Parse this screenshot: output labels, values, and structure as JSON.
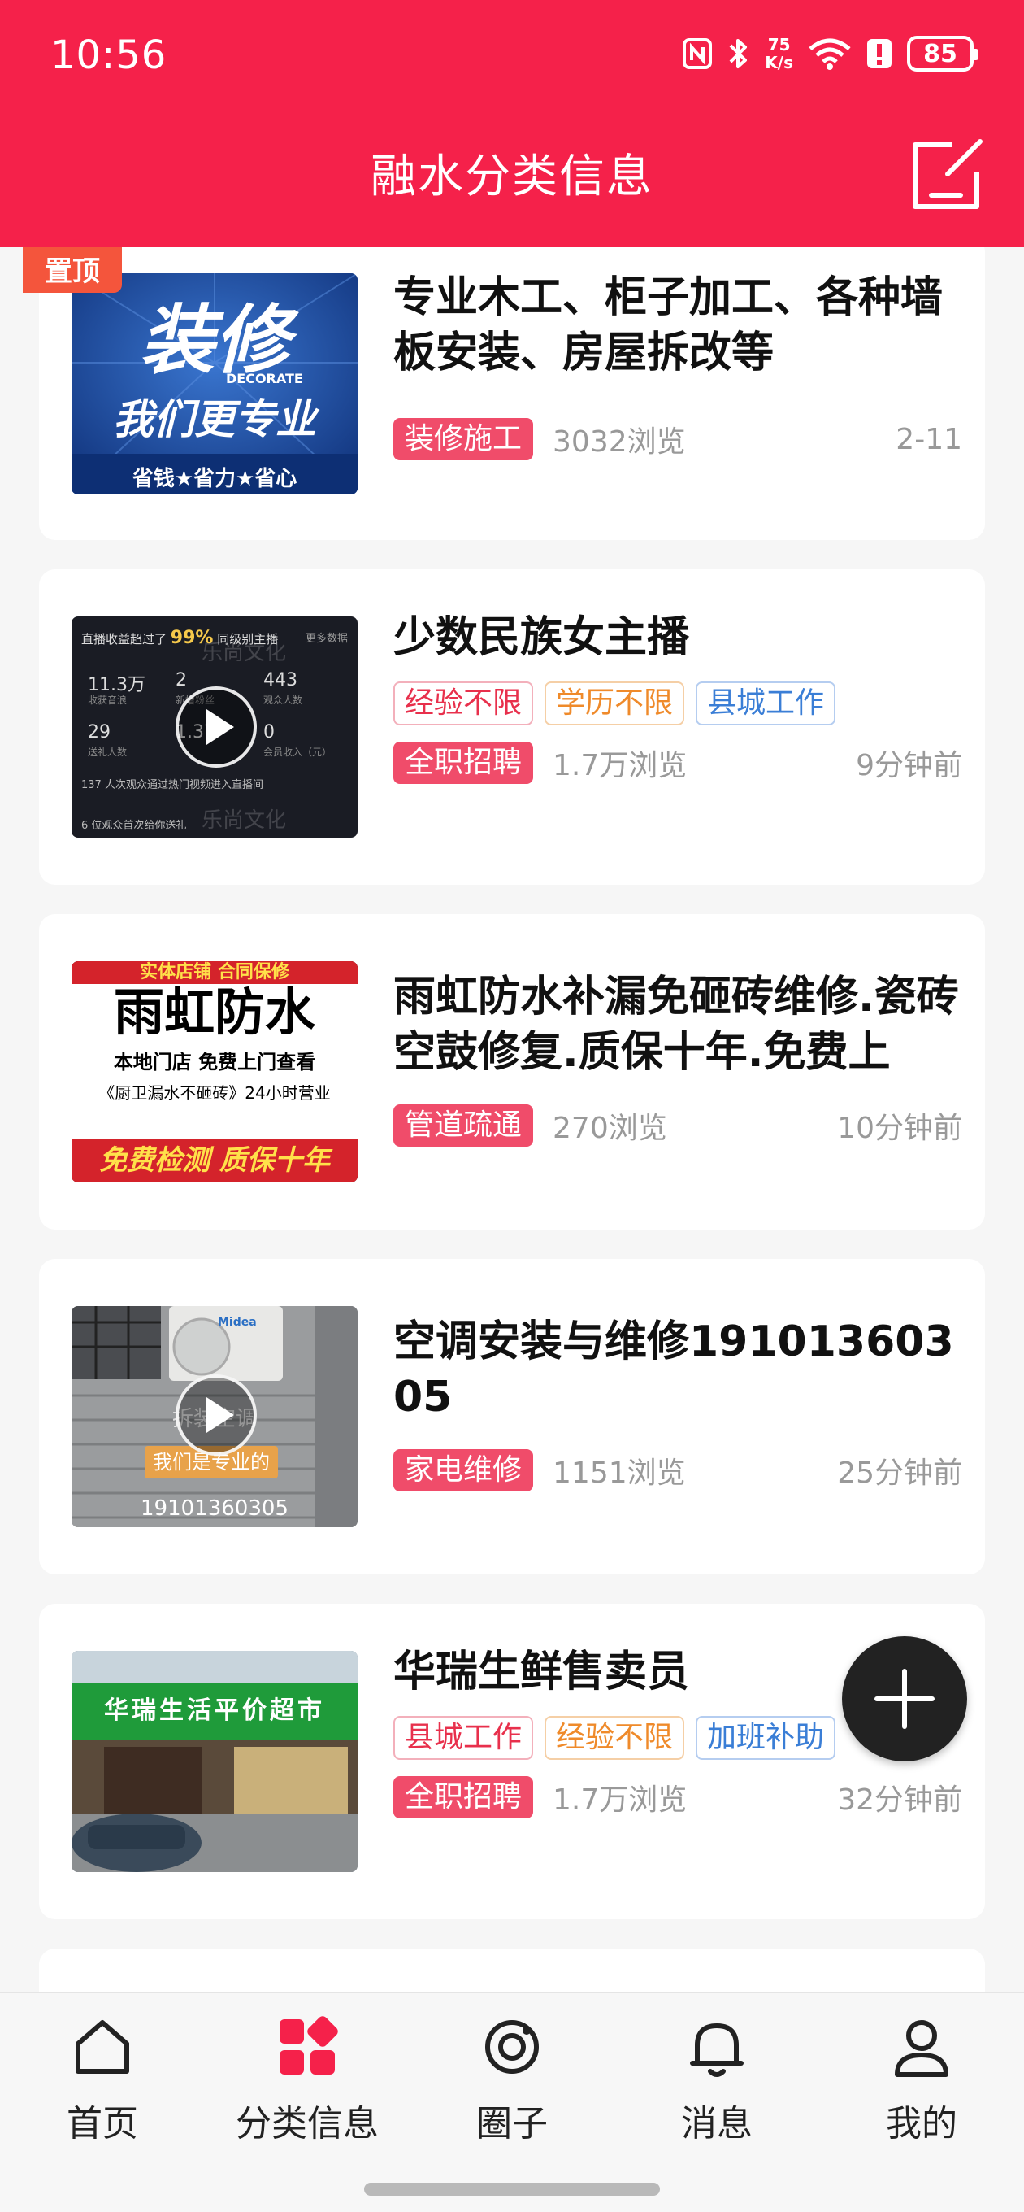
{
  "status_bar": {
    "time": "10:56",
    "net_speed_value": "75",
    "net_speed_unit": "K/s",
    "battery": "85"
  },
  "header": {
    "title": "融水分类信息"
  },
  "colors": {
    "brand": "#f5214a",
    "badge": "#f04c6a",
    "pin": "#f4553c"
  },
  "listings": [
    {
      "pinned_label": "置顶",
      "title": "专业木工、柜子加工、各种墙板安装、房屋拆改等",
      "tags": [],
      "category": "装修施工",
      "views": "3032浏览",
      "time": "2-11",
      "thumb": {
        "line1": "装修",
        "line2": "DECORATE",
        "line3": "我们更专业",
        "line4": "省钱★省力★省心"
      }
    },
    {
      "title": "少数民族女主播",
      "tags": [
        "经验不限",
        "学历不限",
        "县城工作"
      ],
      "category": "全职招聘",
      "views": "1.7万浏览",
      "time": "9分钟前",
      "thumb": {
        "line1": "直播收益超过了",
        "line1b": "99%",
        "line1c": "同级别主播",
        "more": "更多数据",
        "n1": "11.3万",
        "n1l": "收获音浪",
        "n2": "2",
        "n2l": "新增粉丝",
        "n3": "443",
        "n3l": "观众人数",
        "n4": "29",
        "n4l": "送礼人数",
        "n5": "1.37",
        "n6": "0",
        "n6l": "会员收入（元）",
        "row": "137 人次观众通过热门视频进入直播间",
        "bottom": "6 位观众首次给你送礼",
        "watermark": "乐尚文化"
      }
    },
    {
      "title": "雨虹防水补漏免砸砖维修.瓷砖空鼓修复.质保十年.免费上",
      "tags": [],
      "category": "管道疏通",
      "views": "270浏览",
      "time": "10分钟前",
      "thumb": {
        "top": "实体店铺 合同保修",
        "main": "雨虹防水",
        "l1": "本地门店  免费上门查看",
        "l2": "《厨卫漏水不砸砖》24小时营业",
        "l3": "免费检测  质保十年"
      }
    },
    {
      "title": "空调安装与维修19101360305",
      "tags": [],
      "category": "家电维修",
      "views": "1151浏览",
      "time": "25分钟前",
      "thumb": {
        "cap1": "拆装空调",
        "cap2": "我们是专业的",
        "phone": "19101360305",
        "brand": "Midea"
      }
    },
    {
      "title": "华瑞生鲜售卖员",
      "tags": [
        "县城工作",
        "经验不限",
        "加班补助"
      ],
      "category": "全职招聘",
      "views": "1.7万浏览",
      "time": "32分钟前",
      "thumb": {
        "sign": "华瑞生活平价超市"
      }
    }
  ],
  "bottom_nav": [
    {
      "label": "首页",
      "icon": "home-icon"
    },
    {
      "label": "分类信息",
      "icon": "category-grid-icon",
      "active": true
    },
    {
      "label": "圈子",
      "icon": "circle-icon"
    },
    {
      "label": "消息",
      "icon": "bell-icon"
    },
    {
      "label": "我的",
      "icon": "profile-icon"
    }
  ]
}
